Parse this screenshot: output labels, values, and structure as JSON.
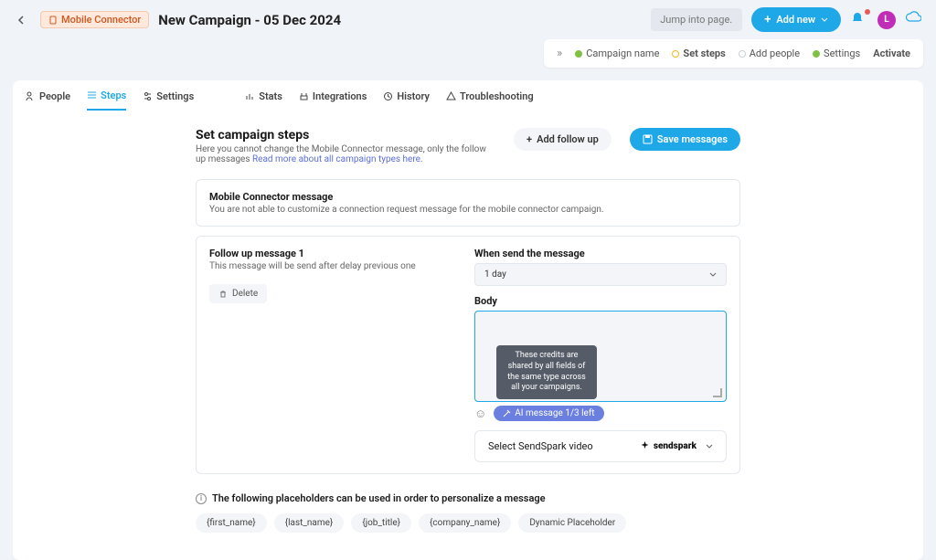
{
  "header": {
    "badge": "Mobile Connector",
    "title": "New Campaign - 05 Dec 2024",
    "search_placeholder": "Jump into page...",
    "add_new": "Add new",
    "avatar_initial": "L"
  },
  "progress": {
    "steps": [
      {
        "label": "Campaign name",
        "state": "done"
      },
      {
        "label": "Set steps",
        "state": "active"
      },
      {
        "label": "Add people",
        "state": "todo"
      },
      {
        "label": "Settings",
        "state": "done"
      },
      {
        "label": "Activate",
        "state": "todo-plain"
      }
    ]
  },
  "tabs": {
    "people": "People",
    "steps": "Steps",
    "settings": "Settings",
    "stats": "Stats",
    "integrations": "Integrations",
    "history": "History",
    "troubleshooting": "Troubleshooting"
  },
  "page": {
    "heading": "Set campaign steps",
    "subtext": "Here you cannot change the Mobile Connector message, only the follow up messages ",
    "sublink": "Read more about all campaign types here.",
    "add_follow": "Add follow up",
    "save": "Save messages"
  },
  "card1": {
    "title": "Mobile Connector message",
    "sub": "You are not able to customize a connection request message for the mobile connector campaign."
  },
  "followup": {
    "title": "Follow up message 1",
    "sub": "This message will be send after delay previous one",
    "delete": "Delete",
    "when_label": "When send the message",
    "when_value": "1 day",
    "body_label": "Body",
    "ai_label": "AI message 1/3 left",
    "tooltip": "These credits are shared by all fields of the same type across all your campaigns."
  },
  "sendspark": {
    "label": "Select SendSpark video",
    "brand": "sendspark"
  },
  "placeholders": {
    "intro": "The following placeholders can be used in order to personalize a message",
    "items": [
      "{first_name}",
      "{last_name}",
      "{job_title}",
      "{company_name}",
      "Dynamic Placeholder"
    ]
  }
}
